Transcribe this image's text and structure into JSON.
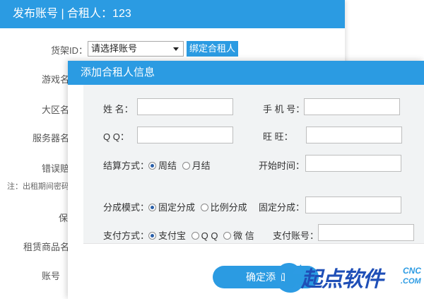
{
  "background": {
    "title": "发布账号 | 合租人：123",
    "fields": {
      "shelf_id_label": "货架ID：",
      "shelf_select_value": "请选择账号",
      "bind_button": "绑定合租人",
      "game_name_label": "游戏名",
      "region_label": "大区名",
      "server_label": "服务器名",
      "error_label": "错误赔",
      "note": "注：出租期间密码",
      "guarantee_label": "保",
      "rent_goods_label": "租赁商品名",
      "account_label": "账号"
    }
  },
  "modal": {
    "title": "添加合租人信息",
    "name_label": "姓    名：",
    "phone_label": "手 机 号：",
    "qq_label": "Q    Q：",
    "wangwang_label": "旺    旺：",
    "settle_label": "结算方式：",
    "settle_options": [
      "周结",
      "月结"
    ],
    "settle_selected": "周结",
    "start_time_label": "开始时间：",
    "split_mode_label": "分成模式：",
    "split_options": [
      "固定分成",
      "比例分成"
    ],
    "split_selected": "固定分成",
    "fixed_split_label": "固定分成：",
    "pay_method_label": "支付方式：",
    "pay_options": [
      "支付宝",
      "Q Q",
      "微 信"
    ],
    "pay_selected": "支付宝",
    "pay_account_label": "支付账号：",
    "confirm_button": "确定添加"
  },
  "watermark": {
    "text": "起点软件",
    "cnc": "CNC",
    "com": ".COM"
  },
  "colors": {
    "accent": "#2b9be2",
    "panel_gray": "#f1f3f4",
    "watermark_blue": "#1f4fb7"
  }
}
